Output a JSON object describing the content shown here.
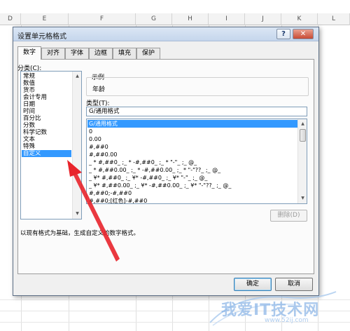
{
  "spreadsheet": {
    "columns": [
      "D",
      "E",
      "F",
      "G",
      "H",
      "I",
      "J",
      "K",
      "L"
    ]
  },
  "dialog": {
    "title": "设置单元格格式",
    "help_label": "?",
    "close_label": "✕",
    "tabs": [
      "数字",
      "对齐",
      "字体",
      "边框",
      "填充",
      "保护"
    ],
    "active_tab": "数字",
    "category_label": "分类(C):",
    "categories": [
      "常规",
      "数值",
      "货币",
      "会计专用",
      "日期",
      "时间",
      "百分比",
      "分数",
      "科学记数",
      "文本",
      "特殊",
      "自定义"
    ],
    "selected_category": "自定义",
    "sample_label": "示例",
    "sample_value": "年龄",
    "type_label": "类型(T):",
    "type_value": "G/通用格式",
    "type_list": [
      "G/通用格式",
      "0",
      "0.00",
      "#,##0",
      "#,##0.00",
      "_ * #,##0_ ;_ * -#,##0_ ;_ * \"-\"_ ;_ @_",
      "_ * #,##0.00_ ;_ * -#,##0.00_ ;_ * \"-\"??_ ;_ @_",
      "_ ¥* #,##0_ ;_ ¥* -#,##0_ ;_ ¥* \"-\"_ ;_ @_",
      "_ ¥* #,##0.00_ ;_ ¥* -#,##0.00_ ;_ ¥* \"-\"??_ ;_ @_",
      "#,##0;-#,##0",
      "#,##0;[红色]-#,##0"
    ],
    "delete_label": "删除(D)",
    "description": "以现有格式为基础，生成自定义的数字格式。",
    "ok_label": "确定",
    "cancel_label": "取消"
  },
  "watermark": {
    "text": "我爱IT技术网",
    "url": "www.52ij.com"
  },
  "colors": {
    "selection": "#3399ff",
    "annotation_arrow": "#e8242b",
    "titlebar": "#c5d6ec"
  },
  "icons": {
    "scroll_up": "triangle-up-icon",
    "scroll_down": "triangle-down-icon"
  }
}
